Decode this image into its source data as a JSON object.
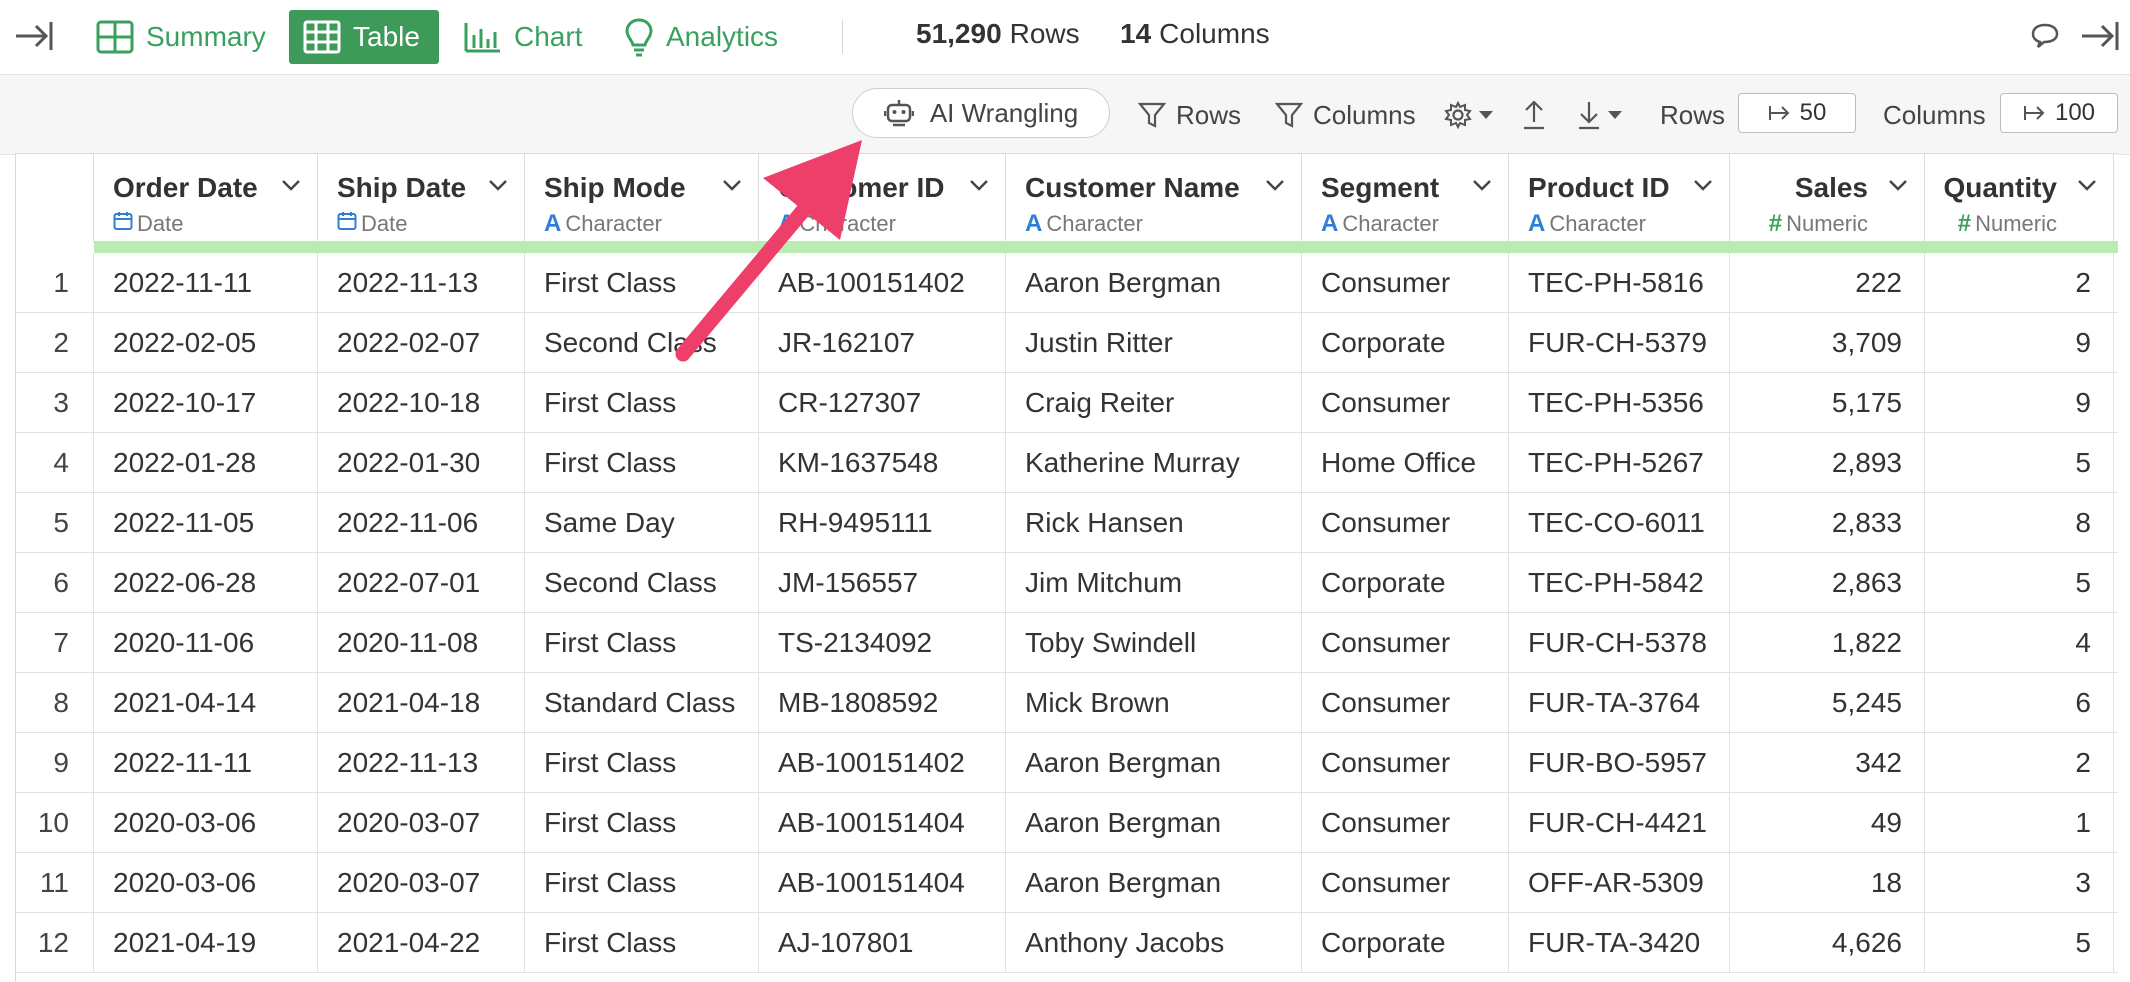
{
  "topbar": {
    "tabs": [
      {
        "label": "Summary",
        "icon": "summary-grid-icon",
        "active": false
      },
      {
        "label": "Table",
        "icon": "table-icon",
        "active": true
      },
      {
        "label": "Chart",
        "icon": "bar-chart-icon",
        "active": false
      },
      {
        "label": "Analytics",
        "icon": "lightbulb-icon",
        "active": false
      }
    ],
    "rows_count": "51,290",
    "rows_word": "Rows",
    "columns_count": "14",
    "columns_word": "Columns"
  },
  "toolbar": {
    "ai_label": "AI Wrangling",
    "rows_filter_label": "Rows",
    "columns_filter_label": "Columns",
    "rows_label": "Rows",
    "rows_value": "50",
    "columns_label": "Columns",
    "columns_value": "100"
  },
  "colors": {
    "accent_green": "#3d9a59",
    "quality_bar": "#b8ecb0",
    "date_icon": "#2f7fd6",
    "char_icon": "#2f7fd6",
    "numeric_icon": "#3aa05f",
    "arrow": "#ee3f6a"
  },
  "table": {
    "columns": [
      {
        "name": "Order Date",
        "type": "Date",
        "type_icon": "calendar-icon"
      },
      {
        "name": "Ship Date",
        "type": "Date",
        "type_icon": "calendar-icon"
      },
      {
        "name": "Ship Mode",
        "type": "Character",
        "type_icon": "character-icon"
      },
      {
        "name": "Customer ID",
        "type": "Character",
        "type_icon": "character-icon"
      },
      {
        "name": "Customer Name",
        "type": "Character",
        "type_icon": "character-icon"
      },
      {
        "name": "Segment",
        "type": "Character",
        "type_icon": "character-icon"
      },
      {
        "name": "Product ID",
        "type": "Character",
        "type_icon": "character-icon"
      },
      {
        "name": "Sales",
        "type": "Numeric",
        "type_icon": "hash-icon"
      },
      {
        "name": "Quantity",
        "type": "Numeric",
        "type_icon": "hash-icon"
      }
    ],
    "rows": [
      [
        "1",
        "2022-11-11",
        "2022-11-13",
        "First Class",
        "AB-100151402",
        "Aaron Bergman",
        "Consumer",
        "TEC-PH-5816",
        "222",
        "2"
      ],
      [
        "2",
        "2022-02-05",
        "2022-02-07",
        "Second Class",
        "JR-162107",
        "Justin Ritter",
        "Corporate",
        "FUR-CH-5379",
        "3,709",
        "9"
      ],
      [
        "3",
        "2022-10-17",
        "2022-10-18",
        "First Class",
        "CR-127307",
        "Craig Reiter",
        "Consumer",
        "TEC-PH-5356",
        "5,175",
        "9"
      ],
      [
        "4",
        "2022-01-28",
        "2022-01-30",
        "First Class",
        "KM-1637548",
        "Katherine Murray",
        "Home Office",
        "TEC-PH-5267",
        "2,893",
        "5"
      ],
      [
        "5",
        "2022-11-05",
        "2022-11-06",
        "Same Day",
        "RH-9495111",
        "Rick Hansen",
        "Consumer",
        "TEC-CO-6011",
        "2,833",
        "8"
      ],
      [
        "6",
        "2022-06-28",
        "2022-07-01",
        "Second Class",
        "JM-156557",
        "Jim Mitchum",
        "Corporate",
        "TEC-PH-5842",
        "2,863",
        "5"
      ],
      [
        "7",
        "2020-11-06",
        "2020-11-08",
        "First Class",
        "TS-2134092",
        "Toby Swindell",
        "Consumer",
        "FUR-CH-5378",
        "1,822",
        "4"
      ],
      [
        "8",
        "2021-04-14",
        "2021-04-18",
        "Standard Class",
        "MB-1808592",
        "Mick Brown",
        "Consumer",
        "FUR-TA-3764",
        "5,245",
        "6"
      ],
      [
        "9",
        "2022-11-11",
        "2022-11-13",
        "First Class",
        "AB-100151402",
        "Aaron Bergman",
        "Consumer",
        "FUR-BO-5957",
        "342",
        "2"
      ],
      [
        "10",
        "2020-03-06",
        "2020-03-07",
        "First Class",
        "AB-100151404",
        "Aaron Bergman",
        "Consumer",
        "FUR-CH-4421",
        "49",
        "1"
      ],
      [
        "11",
        "2020-03-06",
        "2020-03-07",
        "First Class",
        "AB-100151404",
        "Aaron Bergman",
        "Consumer",
        "OFF-AR-5309",
        "18",
        "3"
      ],
      [
        "12",
        "2021-04-19",
        "2021-04-22",
        "First Class",
        "AJ-107801",
        "Anthony Jacobs",
        "Corporate",
        "FUR-TA-3420",
        "4,626",
        "5"
      ]
    ]
  }
}
